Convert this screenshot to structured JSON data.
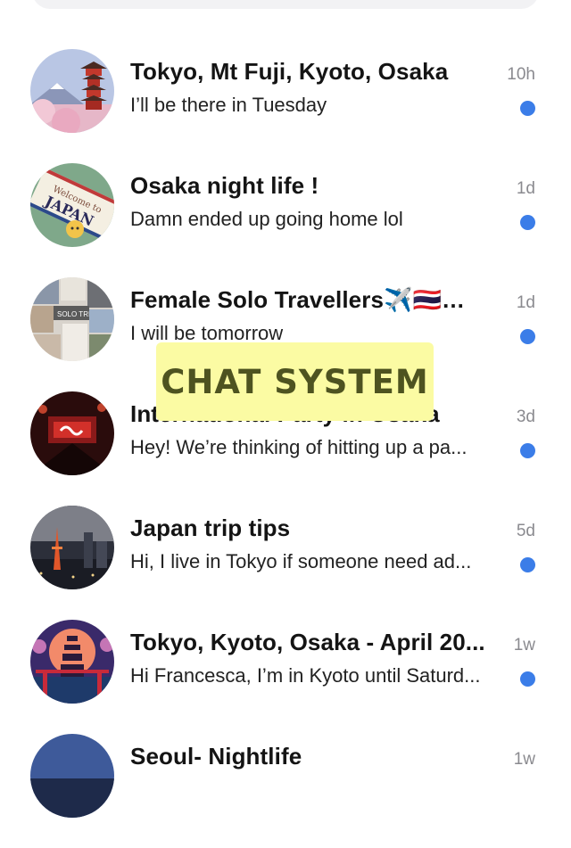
{
  "chats": [
    {
      "title": "Tokyo, Mt Fuji, Kyoto, Osaka",
      "time": "10h",
      "preview": "I’ll be there in Tuesday",
      "unread": true,
      "avatar_icon": "pagoda-fuji-icon"
    },
    {
      "title": "Osaka night life !",
      "time": "1d",
      "preview": "Damn ended up going home lol",
      "unread": true,
      "avatar_icon": "welcome-japan-stamp-icon"
    },
    {
      "title": "Female Solo Travellers✈️🇹🇭…",
      "time": "1d",
      "preview": "I will be tomorrow",
      "unread": true,
      "avatar_icon": "collage-icon"
    },
    {
      "title": "International Party in Osaka",
      "time": "3d",
      "preview": "Hey! We’re thinking of hitting up a pa...",
      "unread": true,
      "avatar_icon": "club-stage-icon"
    },
    {
      "title": "Japan trip tips",
      "time": "5d",
      "preview": "Hi, I live in Tokyo if someone need ad...",
      "unread": true,
      "avatar_icon": "tokyo-tower-night-icon"
    },
    {
      "title": "Tokyo, Kyoto, Osaka - April 20...",
      "time": "1w",
      "preview": "Hi Francesca, I’m in Kyoto until Saturd...",
      "unread": true,
      "avatar_icon": "torii-pagoda-icon"
    },
    {
      "title": "Seoul- Nightlife",
      "time": "1w",
      "preview": "",
      "unread": false,
      "avatar_icon": "city-night-icon"
    }
  ],
  "overlay": {
    "text": "CHAT SYSTEM"
  },
  "avatar_labels": {
    "welcome": "Welcome to",
    "japan": "JAPAN",
    "solo": "SOLO TRIP"
  },
  "colors": {
    "unread_dot": "#3b7de8",
    "overlay_bg": "#fbfba3",
    "overlay_text": "#4e5320",
    "time": "#8a8a8f"
  }
}
